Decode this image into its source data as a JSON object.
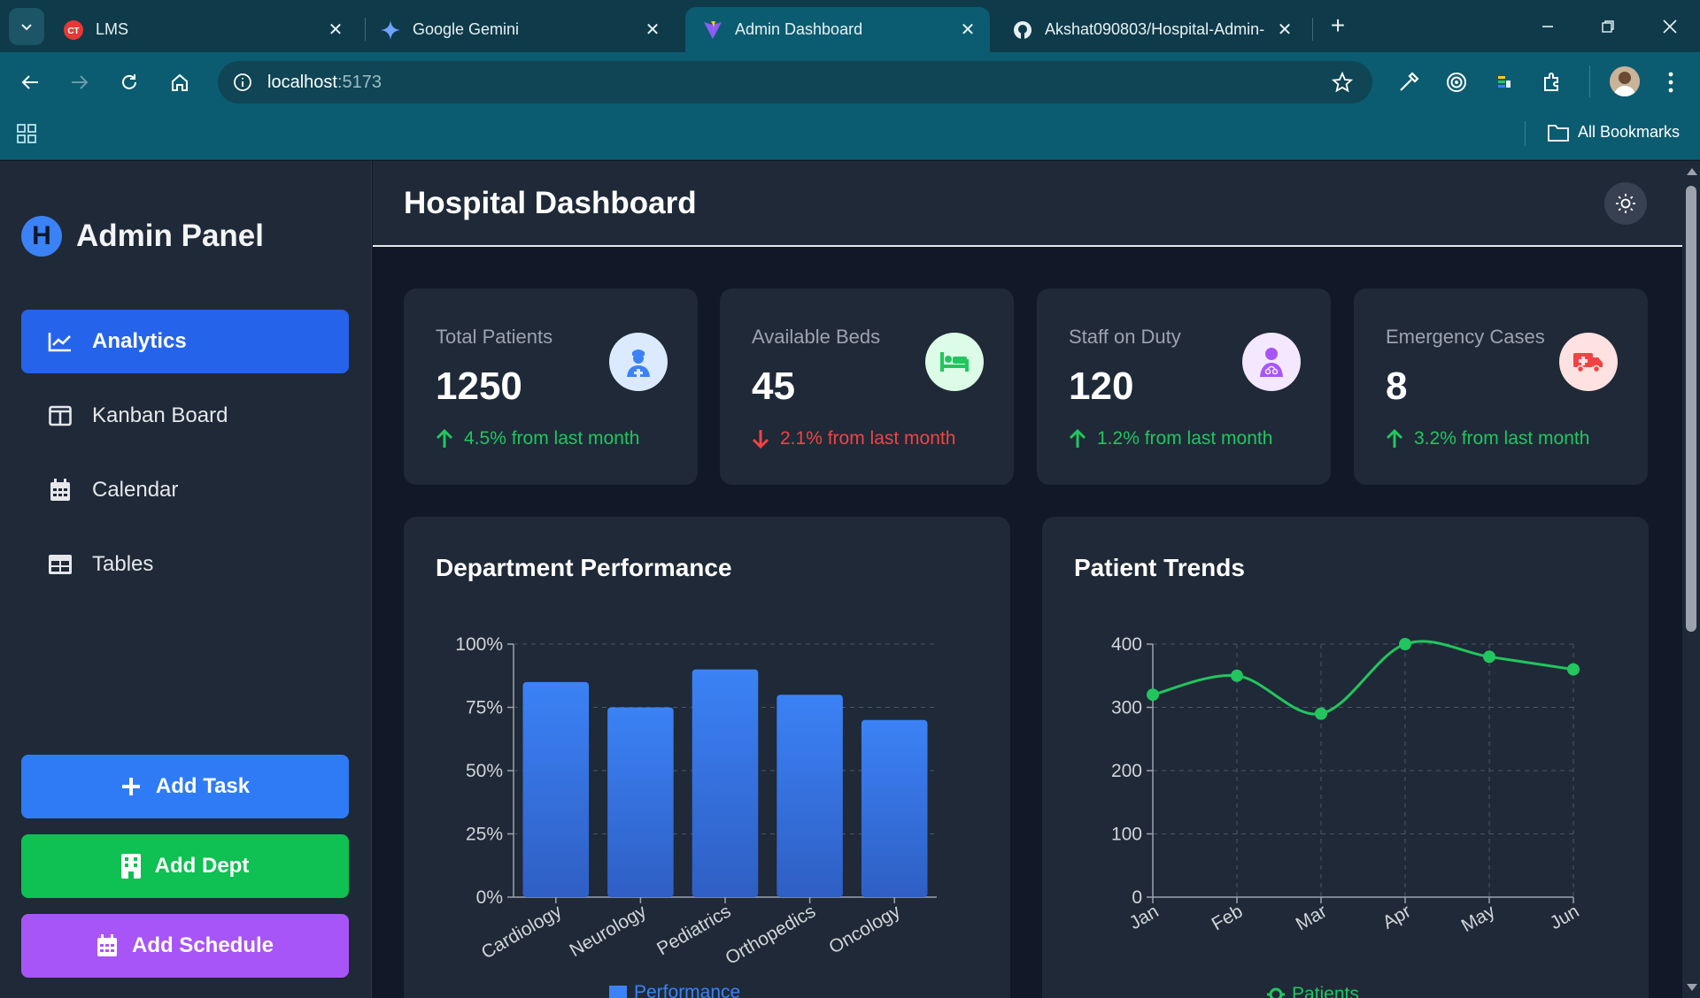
{
  "browser": {
    "tabs": [
      {
        "title": "LMS",
        "icon": "lms-logo-icon"
      },
      {
        "title": "Google Gemini",
        "icon": "gemini-sparkle-icon"
      },
      {
        "title": "Admin Dashboard",
        "icon": "vite-logo-icon",
        "active": true
      },
      {
        "title": "Akshat090803/Hospital-Admin-",
        "icon": "github-icon"
      }
    ],
    "url_host": "localhost",
    "url_port": ":5173",
    "bookmarks_label": "All Bookmarks"
  },
  "sidebar": {
    "logo_letter": "H",
    "title": "Admin Panel",
    "items": [
      {
        "label": "Analytics",
        "icon": "chart-line-icon",
        "active": true
      },
      {
        "label": "Kanban Board",
        "icon": "columns-icon"
      },
      {
        "label": "Calendar",
        "icon": "calendar-icon"
      },
      {
        "label": "Tables",
        "icon": "table-icon"
      }
    ],
    "actions": [
      {
        "label": "Add Task",
        "icon": "plus-icon",
        "color": "#2f7bf5"
      },
      {
        "label": "Add Dept",
        "icon": "building-icon",
        "color": "#0fc052"
      },
      {
        "label": "Add Schedule",
        "icon": "calendar-icon",
        "color": "#a855f7"
      }
    ]
  },
  "header": {
    "title": "Hospital Dashboard",
    "theme_icon": "sun-icon"
  },
  "stats": [
    {
      "label": "Total Patients",
      "value": "1250",
      "trend": "4.5% from last month",
      "direction": "up",
      "icon": "user-nurse-icon",
      "icon_bg": "#dbeafe",
      "icon_color": "#3b82f6"
    },
    {
      "label": "Available Beds",
      "value": "45",
      "trend": "2.1% from last month",
      "direction": "down",
      "icon": "bed-icon",
      "icon_bg": "#dcfce7",
      "icon_color": "#22c55e"
    },
    {
      "label": "Staff on Duty",
      "value": "120",
      "trend": "1.2% from last month",
      "direction": "up",
      "icon": "user-doctor-icon",
      "icon_bg": "#f3e8ff",
      "icon_color": "#a855f7"
    },
    {
      "label": "Emergency Cases",
      "value": "8",
      "trend": "3.2% from last month",
      "direction": "up",
      "icon": "ambulance-icon",
      "icon_bg": "#fee2e2",
      "icon_color": "#ef4444"
    }
  ],
  "chart_data": [
    {
      "type": "bar",
      "title": "Department Performance",
      "categories": [
        "Cardiology",
        "Neurology",
        "Pediatrics",
        "Orthopedics",
        "Oncology"
      ],
      "series": [
        {
          "name": "Performance",
          "values": [
            85,
            75,
            90,
            80,
            70
          ]
        }
      ],
      "ylim": [
        0,
        100
      ],
      "yticks": [
        "0%",
        "25%",
        "50%",
        "75%",
        "100%"
      ],
      "grid": true,
      "legend": "bottom",
      "color": "#3b82f6"
    },
    {
      "type": "line",
      "title": "Patient Trends",
      "x": [
        "Jan",
        "Feb",
        "Mar",
        "Apr",
        "May",
        "Jun"
      ],
      "series": [
        {
          "name": "Patients",
          "values": [
            320,
            350,
            290,
            400,
            380,
            360
          ]
        }
      ],
      "ylim": [
        0,
        400
      ],
      "yticks": [
        "0",
        "100",
        "200",
        "300",
        "400"
      ],
      "grid": true,
      "legend": "bottom",
      "color": "#22c55e"
    }
  ]
}
